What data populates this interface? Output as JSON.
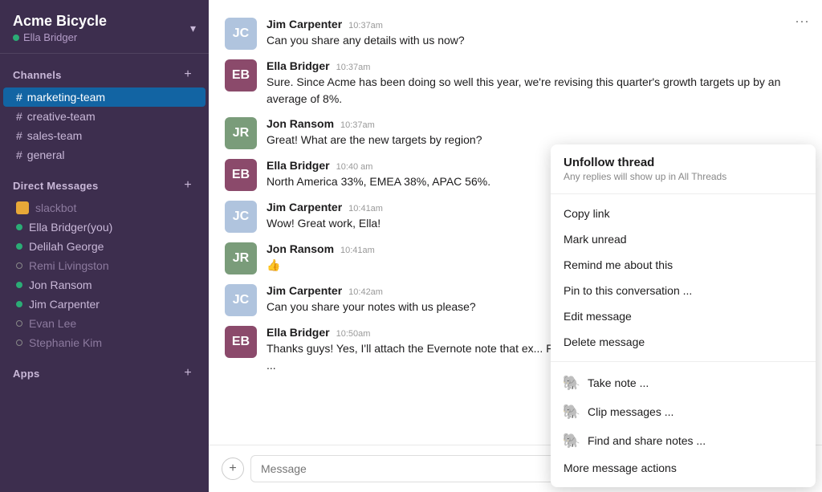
{
  "workspace": {
    "name": "Acme Bicycle",
    "user": "Ella Bridger",
    "chevron": "▾"
  },
  "sidebar": {
    "channels_label": "Channels",
    "channels": [
      {
        "id": "marketing-team",
        "label": "marketing-team",
        "active": true
      },
      {
        "id": "creative-team",
        "label": "creative-team",
        "active": false
      },
      {
        "id": "sales-team",
        "label": "sales-team",
        "active": false
      },
      {
        "id": "general",
        "label": "general",
        "active": false
      }
    ],
    "dm_label": "Direct Messages",
    "dms": [
      {
        "id": "slackbot",
        "label": "slackbot",
        "online": false,
        "type": "bot"
      },
      {
        "id": "ella-bridger",
        "label": "Ella Bridger(you)",
        "online": true,
        "type": "user"
      },
      {
        "id": "delilah-george",
        "label": "Delilah George",
        "online": true,
        "type": "user"
      },
      {
        "id": "remi-livingston",
        "label": "Remi Livingston",
        "online": false,
        "type": "user"
      },
      {
        "id": "jon-ransom",
        "label": "Jon Ransom",
        "online": true,
        "type": "user"
      },
      {
        "id": "jim-carpenter",
        "label": "Jim Carpenter",
        "online": true,
        "type": "user"
      },
      {
        "id": "evan-lee",
        "label": "Evan Lee",
        "online": false,
        "type": "user"
      },
      {
        "id": "stephanie-kim",
        "label": "Stephanie Kim",
        "online": false,
        "type": "user"
      }
    ],
    "apps_label": "Apps",
    "add_icon": "+"
  },
  "messages": [
    {
      "id": 1,
      "author": "Jim Carpenter",
      "time": "10:37am",
      "text": "Can you share any details with us now?",
      "avatar_bg": "#b0c4de",
      "avatar_initials": "JC"
    },
    {
      "id": 2,
      "author": "Ella Bridger",
      "time": "10:37am",
      "text": "Sure. Since Acme has been doing so well this year, we're revising this quarter's growth targets up by an average of 8%.",
      "avatar_bg": "#8b4a6b",
      "avatar_initials": "EB"
    },
    {
      "id": 3,
      "author": "Jon Ransom",
      "time": "10:37am",
      "text": "Great! What are the new targets by region?",
      "avatar_bg": "#7a9c7a",
      "avatar_initials": "JR"
    },
    {
      "id": 4,
      "author": "Ella Bridger",
      "time": "10:40 am",
      "text": "North America 33%, EMEA 38%, APAC 56%.",
      "avatar_bg": "#8b4a6b",
      "avatar_initials": "EB"
    },
    {
      "id": 5,
      "author": "Jim Carpenter",
      "time": "10:41am",
      "text": "Wow! Great work, Ella!",
      "avatar_bg": "#b0c4de",
      "avatar_initials": "JC"
    },
    {
      "id": 6,
      "author": "Jon Ransom",
      "time": "10:41am",
      "text": "👍",
      "avatar_bg": "#7a9c7a",
      "avatar_initials": "JR"
    },
    {
      "id": 7,
      "author": "Jim Carpenter",
      "time": "10:42am",
      "text": "Can you share your notes with us please?",
      "avatar_bg": "#b0c4de",
      "avatar_initials": "JC"
    },
    {
      "id": 8,
      "author": "Ella Bridger",
      "time": "10:50am",
      "text": "Thanks guys! Yes, I'll attach the Evernote note that ex... Feel free to make comments in the note and we can ...",
      "avatar_bg": "#8b4a6b",
      "avatar_initials": "EB"
    }
  ],
  "message_input": {
    "placeholder": "Message"
  },
  "context_menu": {
    "unfollow_title": "Unfollow thread",
    "unfollow_sub": "Any replies will show up in All Threads",
    "items_middle": [
      "Copy link",
      "Mark unread",
      "Remind me about this",
      "Pin to this conversation ...",
      "Edit message",
      "Delete message"
    ],
    "items_evernote": [
      "Take note ...",
      "Clip messages ...",
      "Find and share notes ..."
    ],
    "more_actions": "More message actions"
  },
  "more_icon_label": "···"
}
